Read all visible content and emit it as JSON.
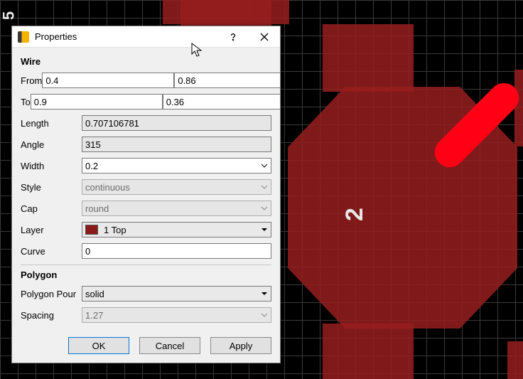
{
  "dialog": {
    "title": "Properties",
    "sections": {
      "wire": "Wire",
      "polygon": "Polygon"
    },
    "labels": {
      "from": "From",
      "to": "To",
      "length": "Length",
      "angle": "Angle",
      "width": "Width",
      "style": "Style",
      "cap": "Cap",
      "layer": "Layer",
      "curve": "Curve",
      "pour": "Polygon Pour",
      "spacing": "Spacing"
    },
    "values": {
      "from_x": "0.4",
      "from_y": "0.86",
      "to_x": "0.9",
      "to_y": "0.36",
      "length": "0.707106781",
      "angle": "315",
      "width": "0.2",
      "style": "continuous",
      "cap": "round",
      "layer": "1 Top",
      "curve": "0",
      "pour": "solid",
      "spacing": "1.27"
    },
    "buttons": {
      "ok": "OK",
      "cancel": "Cancel",
      "apply": "Apply"
    },
    "layer_color": "#8b1a1a"
  },
  "canvas": {
    "pad_labels": {
      "p5": "5",
      "p2": "2"
    }
  }
}
